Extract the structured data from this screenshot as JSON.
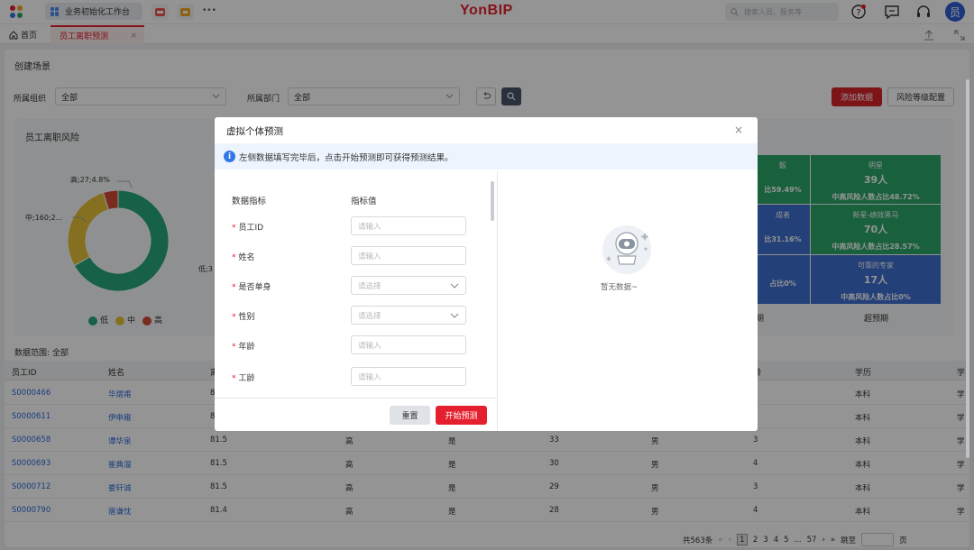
{
  "topbar": {
    "workbench_label": "业务初始化工作台",
    "more_label": "•••",
    "brand": "YonBIP",
    "search_placeholder": "搜索人员、服务等",
    "avatar_text": "员"
  },
  "tabs": {
    "home_label": "首页",
    "active_label": "员工离职预测",
    "close_glyph": "×"
  },
  "page": {
    "title": "创建场景",
    "org_label": "所属组织",
    "org_value": "全部",
    "dept_label": "所属部门",
    "dept_value": "全部",
    "add_button": "添加数据",
    "config_button": "风险等级配置"
  },
  "risk_card": {
    "title": "员工离职风险",
    "pie_labels": {
      "high": "高;27;4.8%",
      "mid": "中;160;2...",
      "low": "低;3"
    },
    "legend": [
      {
        "label": "低",
        "color": "#27a77c"
      },
      {
        "label": "中",
        "color": "#e6c23c"
      },
      {
        "label": "高",
        "color": "#d24a37"
      }
    ]
  },
  "chart_data": {
    "type": "pie",
    "title": "员工离职风险",
    "slices": [
      {
        "label": "低",
        "value": 376,
        "color": "#27a77c"
      },
      {
        "label": "中",
        "value": 160,
        "color": "#e6c23c"
      },
      {
        "label": "高",
        "value": 27,
        "color": "#d24a37"
      }
    ]
  },
  "matrix": {
    "cells": [
      {
        "title": "骰",
        "count": "",
        "pct": "比59.49%",
        "color": "#2ca86a"
      },
      {
        "title": "明星",
        "count": "39人",
        "pct": "中高风险人数占比48.72%",
        "color": "#2ca86a"
      },
      {
        "title": "成者",
        "count": "",
        "pct": "比31.16%",
        "color": "#3d6fd0"
      },
      {
        "title": "新星-绩效黑马",
        "count": "70人",
        "pct": "中高风险人数占比28.57%",
        "color": "#2ca86a"
      },
      {
        "title": "",
        "count": "",
        "pct": "占比0%",
        "color": "#3d6fd0"
      },
      {
        "title": "可靠的专家",
        "count": "17人",
        "pct": "中高风险人数占比0%",
        "color": "#3d6fd0"
      }
    ],
    "x_labels": [
      "期",
      "超预期"
    ]
  },
  "table": {
    "range_label": "数据范围:",
    "range_value": "全部",
    "headers": [
      "员工ID",
      "姓名",
      "离",
      "",
      "",
      "",
      "",
      "龄",
      "学历",
      "学"
    ],
    "rows": [
      [
        "S0000466",
        "华熠甫",
        "81",
        "",
        "",
        "",
        "",
        "",
        "本科",
        "学"
      ],
      [
        "S0000611",
        "伊申雍",
        "8",
        "",
        "",
        "",
        "",
        "",
        "本科",
        "学"
      ],
      [
        "S0000658",
        "谭华泉",
        "81.5",
        "高",
        "是",
        "33",
        "男",
        "3",
        "本科",
        "学"
      ],
      [
        "S0000693",
        "崔典溜",
        "81.5",
        "高",
        "是",
        "30",
        "男",
        "4",
        "本科",
        "学"
      ],
      [
        "S0000712",
        "娄轩诚",
        "81.5",
        "高",
        "是",
        "29",
        "男",
        "3",
        "本科",
        "学"
      ],
      [
        "S0000790",
        "蓿谦忱",
        "81.4",
        "高",
        "是",
        "28",
        "男",
        "4",
        "本科",
        "学"
      ]
    ]
  },
  "pager": {
    "total": "共563条",
    "first": "«",
    "prev": "‹",
    "pages": [
      "1",
      "2",
      "3",
      "4",
      "5"
    ],
    "ellipsis": "...",
    "last_page": "57",
    "next": "›",
    "last": "»",
    "jump_label": "跳至",
    "page_suffix": "页"
  },
  "modal": {
    "title": "虚拟个体预测",
    "close_glyph": "×",
    "info_icon": "i",
    "info_text": "左侧数据填写完毕后，点击开始预测即可获得预测结果。",
    "col_metric": "数据指标",
    "col_value": "指标值",
    "required_mark": "*",
    "fields": [
      {
        "label": "员工ID",
        "placeholder": "请输入",
        "type": "input"
      },
      {
        "label": "姓名",
        "placeholder": "请输入",
        "type": "input"
      },
      {
        "label": "是否单身",
        "placeholder": "请选择",
        "type": "select"
      },
      {
        "label": "性别",
        "placeholder": "请选择",
        "type": "select"
      },
      {
        "label": "年龄",
        "placeholder": "请输入",
        "type": "input"
      },
      {
        "label": "工龄",
        "placeholder": "请输入",
        "type": "input"
      }
    ],
    "reset_button": "重置",
    "start_button": "开始预测",
    "empty_text": "暂无数据~"
  }
}
